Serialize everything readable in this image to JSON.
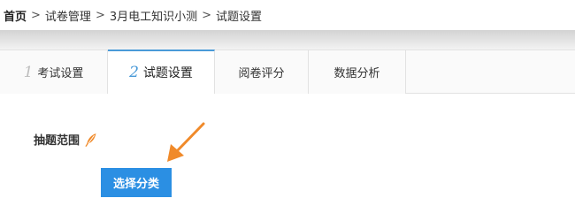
{
  "breadcrumb": {
    "separator": ">",
    "items": [
      "首页",
      "试卷管理",
      "3月电工知识小测",
      "试题设置"
    ]
  },
  "tabs": [
    {
      "number": "1",
      "label": "考试设置",
      "active": false
    },
    {
      "number": "2",
      "label": "试题设置",
      "active": true
    },
    {
      "number": "",
      "label": "阅卷评分",
      "active": false
    },
    {
      "number": "",
      "label": "数据分析",
      "active": false
    }
  ],
  "content": {
    "field_label": "抽题范围",
    "hint_icon": "feather-icon",
    "select_button_label": "选择分类"
  },
  "colors": {
    "accent": "#4a9ad8",
    "button_bg": "#2b8fe3",
    "annotation_arrow": "#f08a2a",
    "feather": "#f08a2a"
  }
}
